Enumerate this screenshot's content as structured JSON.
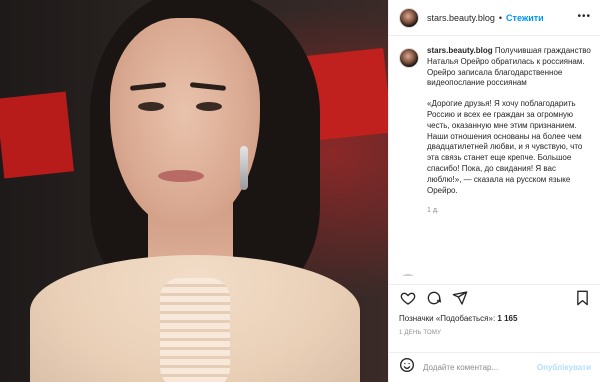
{
  "post": {
    "username": "stars.beauty.blog",
    "follow_label": "Стежити",
    "separator": "•",
    "more_icon": "more-dots-icon"
  },
  "caption": {
    "username": "stars.beauty.blog",
    "paragraph1": "Получившая гражданство Наталья Орейро обратилась к россиянам. Орейро записала благодарственное видеопослание россиянам",
    "paragraph2": "«Дорогие друзья! Я хочу поблагодарить Россию и всех ее граждан за огромную честь, оказанную мне этим признанием. Наши отношения основаны на более чем двадцатилетней любви, и я чувствую, что эта связь станет еще крепче. Большое спасибо! Пока, до свидания! Я вас люблю!», — сказала на русском языке Орейро.",
    "time": "1 д."
  },
  "actions": {
    "like_icon": "heart-icon",
    "comment_icon": "comment-icon",
    "share_icon": "send-icon",
    "save_icon": "bookmark-icon"
  },
  "likes": {
    "prefix": "Позначки «Подобається»:",
    "count": "1 165"
  },
  "posted_ago": "1 ДЕНЬ ТОМУ",
  "comment_box": {
    "placeholder": "Додайте коментар...",
    "publish_label": "Опублікувати",
    "emoji_icon": "smiley-icon"
  },
  "colors": {
    "accent": "#0095f6",
    "publish_disabled": "#b2dffc",
    "muted_text": "#8e8e8e",
    "border": "#efefef"
  }
}
